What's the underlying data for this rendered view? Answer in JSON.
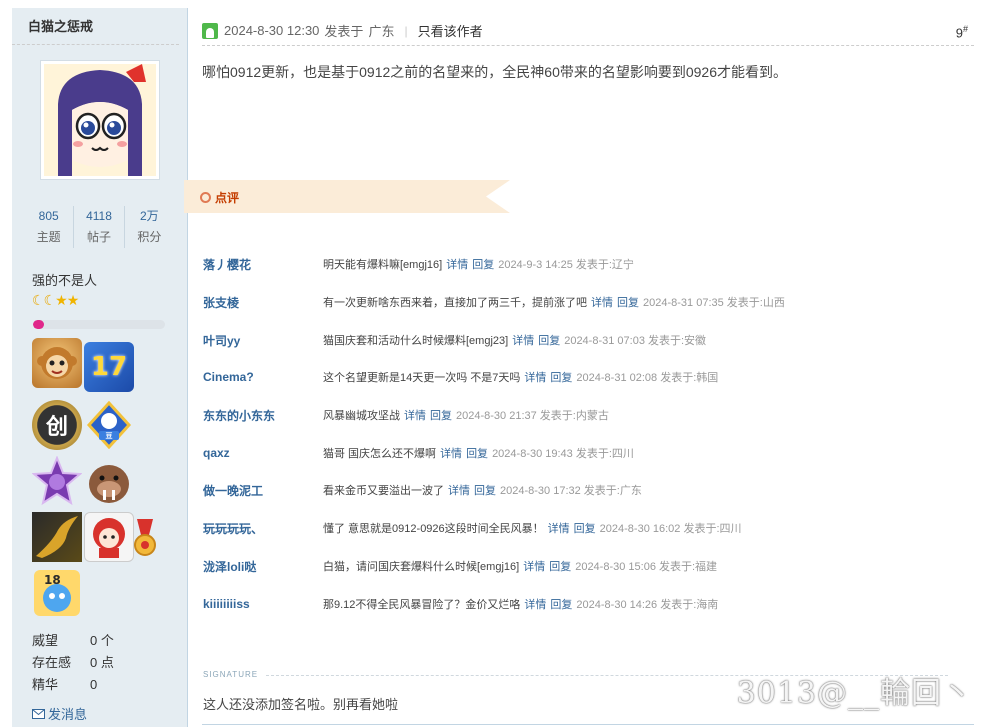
{
  "user": {
    "name": "白猫之惩戒",
    "stats": [
      {
        "value": "805",
        "label": "主题"
      },
      {
        "value": "4118",
        "label": "帖子"
      },
      {
        "value": "2万",
        "label": "积分"
      }
    ],
    "title": "强的不是人",
    "rank_icons": [
      "moon-icon",
      "moon-icon",
      "star-icon",
      "star-icon"
    ],
    "level_progress": 0.08,
    "medals": [
      "monkey-medal",
      "17-medal",
      "chuang-medal",
      "douban-medal",
      "purple-star-medal",
      "walrus-medal",
      "golden-dragon-medal",
      "red-hair-girl-medal",
      "ribbon-medal",
      "18-medal"
    ],
    "info": [
      {
        "key": "威望",
        "value": "0 个"
      },
      {
        "key": "存在感",
        "value": "0 点"
      },
      {
        "key": "精华",
        "value": "0"
      }
    ],
    "message_link": "发消息"
  },
  "post": {
    "date": "2024-8-30 12:30",
    "posted_from_label": "发表于",
    "location": "广东",
    "only_author_link": "只看该作者",
    "floor": "9",
    "floor_mark": "#",
    "content": "哪怕0912更新，也是基于0912之前的名望来的，全民神60带来的名望影响要到0926才能看到。"
  },
  "rate_label": "点评",
  "comments": [
    {
      "user": "落丿樱花",
      "text": "明天能有爆料嘛[emgj16]",
      "detail": "详情",
      "reply": "回复",
      "time": "2024-9-3 14:25 发表于:辽宁"
    },
    {
      "user": "张支棱",
      "text": "有一次更新啥东西来着，直接加了两三千，提前涨了吧",
      "detail": "详情",
      "reply": "回复",
      "time": "2024-8-31 07:35 发表于:山西"
    },
    {
      "user": "叶司yy",
      "text": "猫国庆套和活动什么时候爆料[emgj23]",
      "detail": "详情",
      "reply": "回复",
      "time": "2024-8-31 07:03 发表于:安徽"
    },
    {
      "user": "Cinema?",
      "text": "这个名望更新是14天更一次吗 不是7天吗",
      "detail": "详情",
      "reply": "回复",
      "time": "2024-8-31 02:08 发表于:韩国"
    },
    {
      "user": "东东的小东东",
      "text": "风暴幽城攻坚战",
      "detail": "详情",
      "reply": "回复",
      "time": "2024-8-30 21:37 发表于:内蒙古"
    },
    {
      "user": "qaxz",
      "text": "猫哥 国庆怎么还不爆啊",
      "detail": "详情",
      "reply": "回复",
      "time": "2024-8-30 19:43 发表于:四川"
    },
    {
      "user": "做一晚泥工",
      "text": "看来金币又要溢出一波了",
      "detail": "详情",
      "reply": "回复",
      "time": "2024-8-30 17:32 发表于:广东"
    },
    {
      "user": "玩玩玩玩、",
      "text": "懂了 意思就是0912-0926这段时间全民风暴！",
      "detail": "详情",
      "reply": "回复",
      "time": "2024-8-30 16:02 发表于:四川"
    },
    {
      "user": "泷泽loli哒",
      "text": "白猫，请问国庆套爆料什么时候[emgj16]",
      "detail": "详情",
      "reply": "回复",
      "time": "2024-8-30 15:06 发表于:福建"
    },
    {
      "user": "kiiiiiiiiss",
      "text": "那9.12不得全民风暴冒险了？金价又烂咯",
      "detail": "详情",
      "reply": "回复",
      "time": "2024-8-30 14:26 发表于:海南"
    }
  ],
  "signature": {
    "label": "SIGNATURE",
    "text": "这人还没添加签名啦。别再看她啦"
  },
  "watermark": "3013@__輪回丶",
  "colors": {
    "sidebar_bg": "#e5edf2",
    "link_blue": "#336699",
    "rate_red": "#c43d00",
    "progress_pink": "#e0278a",
    "online_green": "#4fb84a"
  }
}
